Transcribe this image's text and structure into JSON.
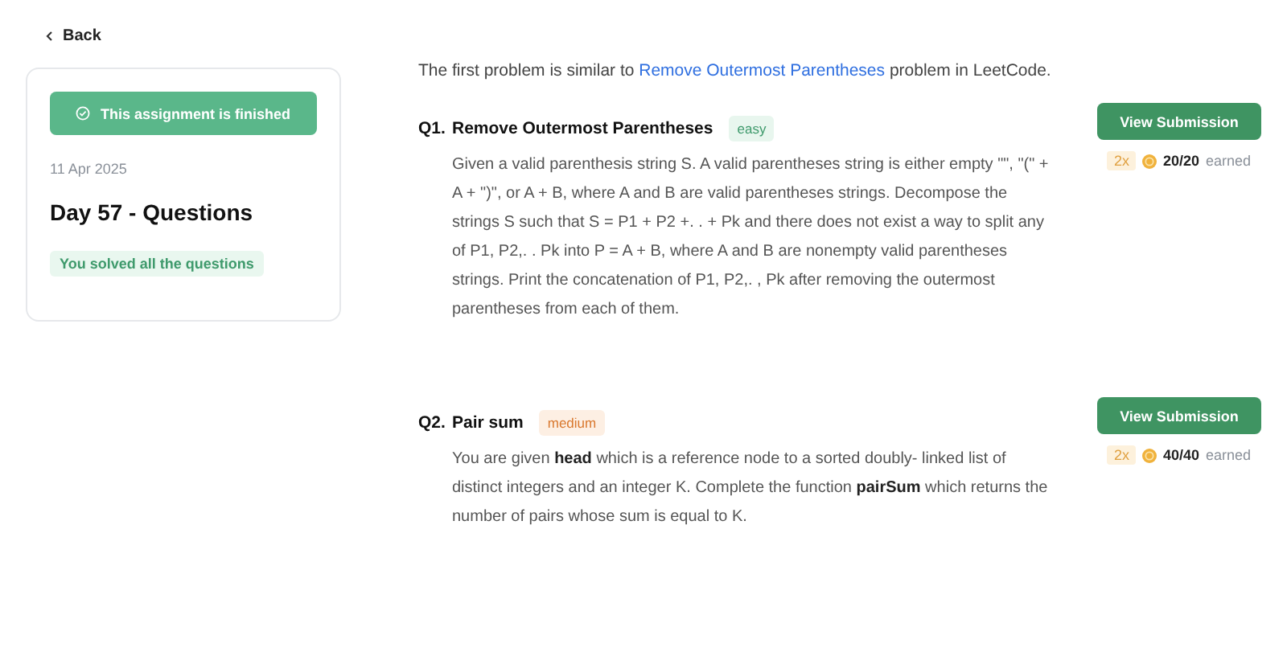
{
  "back": {
    "label": "Back"
  },
  "assignment": {
    "status": "This assignment is finished",
    "finished": true,
    "date": "11 Apr 2025",
    "title": "Day 57 - Questions",
    "summary": "You solved all the questions"
  },
  "intro": {
    "before": "The first problem is similar to ",
    "link": "Remove Outermost Parentheses",
    "after": " problem in LeetCode."
  },
  "questions": [
    {
      "number": "Q1.",
      "title": "Remove Outermost Parentheses",
      "difficulty": "easy",
      "kind": "easy",
      "description": "Given a valid parenthesis string S. A valid parentheses string is either empty \"\", \"(\" + A + \")\", or A + B, where A and B are valid parentheses strings. Decompose the strings S such that S = P1 + P2 +. . + Pk and there does not exist a way to split any of P1, P2,. . Pk into P = A + B, where A and B are nonempty valid parentheses strings. Print the concatenation of P1, P2,. , Pk after removing the outermost parentheses from each of them.",
      "button": "View Submission",
      "multiplier": "2x",
      "score": "20/20",
      "earned": "earned"
    },
    {
      "number": "Q2.",
      "title": "Pair sum",
      "difficulty": "medium",
      "kind": "medium",
      "description": "You are given **head** which is a reference node to a sorted doubly- linked list of distinct integers and an integer K. Complete the function **pairSum** which returns the number of pairs whose sum is equal to K.",
      "button": "View Submission",
      "multiplier": "2x",
      "score": "40/40",
      "earned": "earned"
    }
  ]
}
